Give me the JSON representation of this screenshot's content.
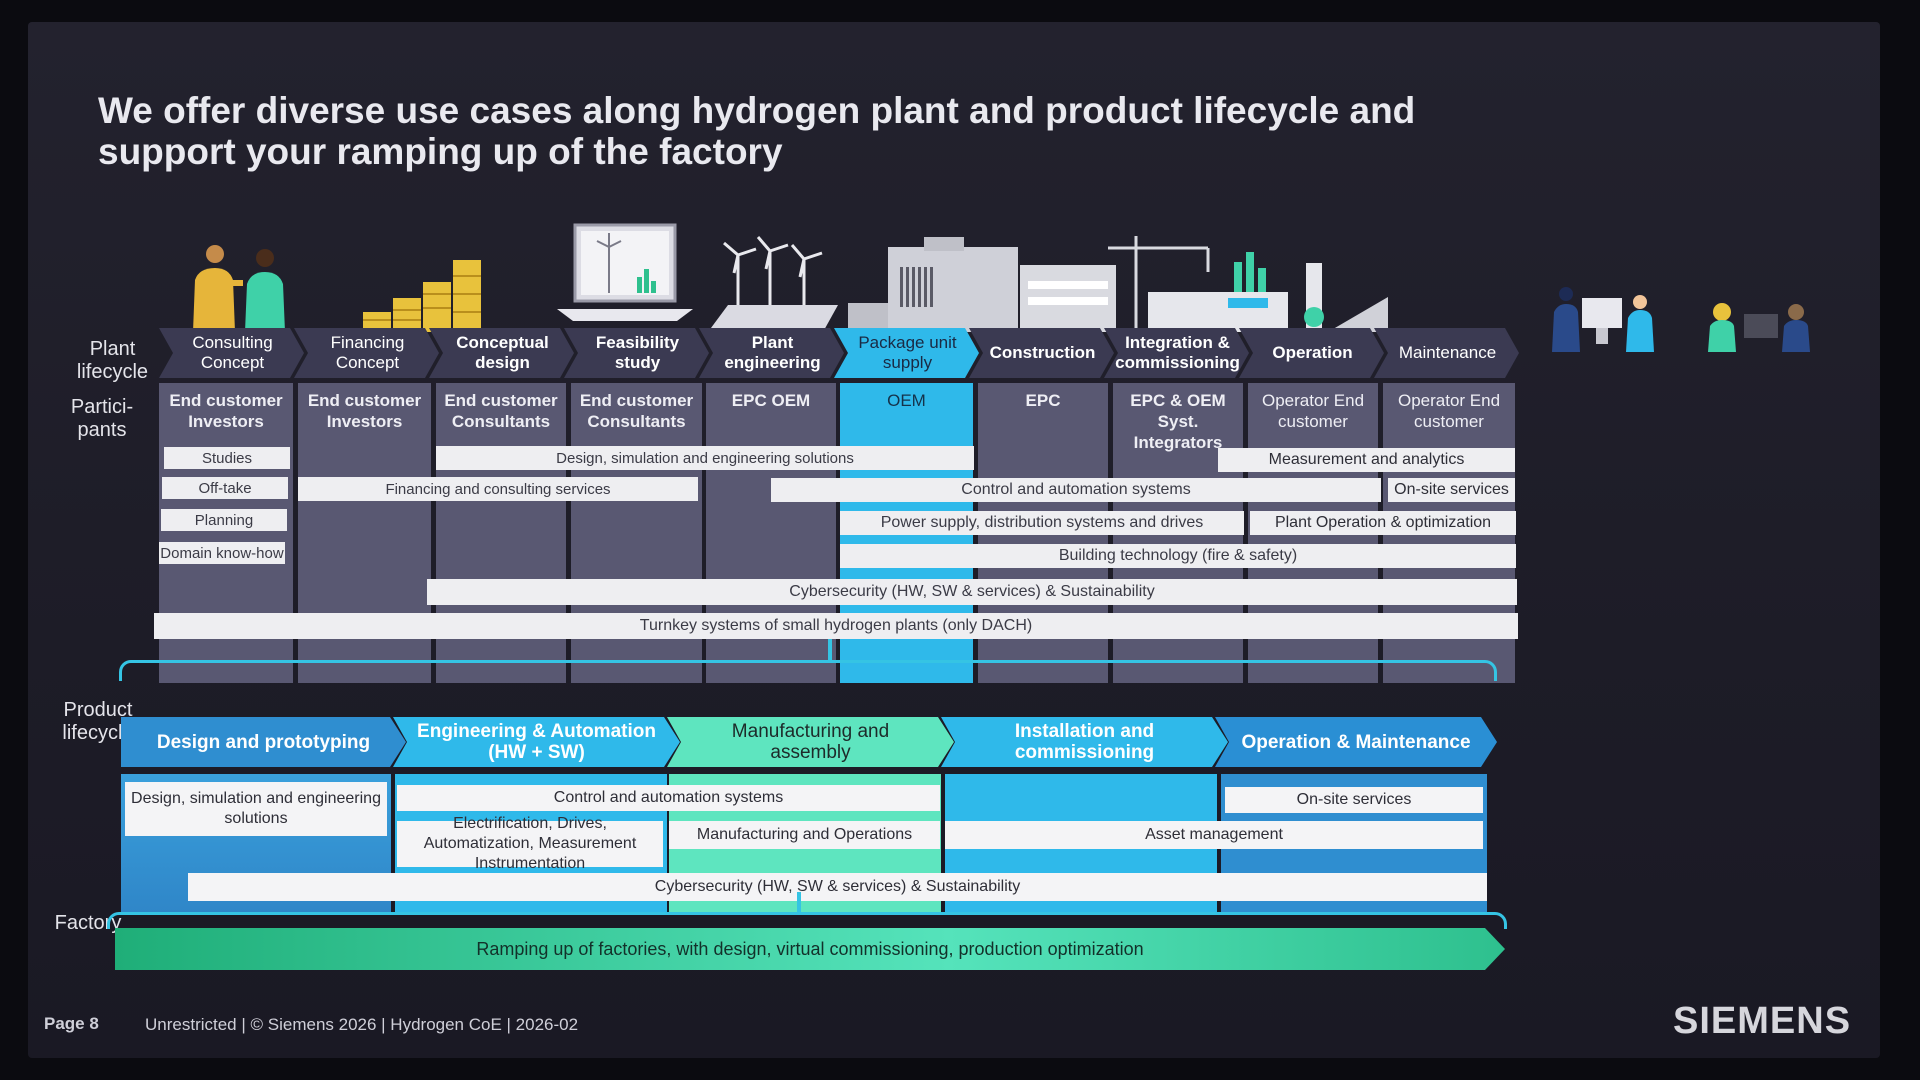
{
  "title": "We offer diverse use cases along hydrogen plant and product lifecycle and support your ramping up of the factory",
  "labels": {
    "plant_lifecycle": "Plant lifecycle",
    "participants": "Partici- pants",
    "product_lifecycle": "Product lifecycle",
    "factory": "Factory"
  },
  "plant": {
    "stages": [
      "Consulting Concept",
      "Financing Concept",
      "Conceptual design",
      "Feasibility study",
      "Plant engineering",
      "Package unit supply",
      "Construction",
      "Integration & commissioning",
      "Operation",
      "Maintenance"
    ],
    "participants": [
      "End customer Investors",
      "End customer Investors",
      "End customer Consultants",
      "End customer Consultants",
      "EPC OEM",
      "OEM",
      "EPC",
      "EPC & OEM Syst. Integrators",
      "Operator End customer",
      "Operator End customer"
    ],
    "small_items": [
      "Studies",
      "Off-take",
      "Planning",
      "Domain know-how"
    ],
    "bars": {
      "design": "Design, simulation and engineering solutions",
      "financing": "Financing and consulting services",
      "measurement": "Measurement and analytics",
      "control": "Control and automation systems",
      "onsite": "On-site services",
      "power": "Power supply, distribution systems and drives",
      "plant_op": "Plant Operation & optimization",
      "building": "Building technology (fire & safety)",
      "cyber": "Cybersecurity (HW, SW & services) & Sustainability",
      "turnkey": "Turnkey systems of small hydrogen plants (only DACH)"
    }
  },
  "product": {
    "stages": [
      "Design and prototyping",
      "Engineering & Automation (HW + SW)",
      "Manufacturing and assembly",
      "Installation and commissioning",
      "Operation & Maintenance"
    ],
    "bars": {
      "design": "Design, simulation and engineering solutions",
      "control": "Control and automation systems",
      "onsite": "On-site services",
      "electrification": "Electrification, Drives, Automatization, Measurement Instrumentation",
      "manufacturing_ops": "Manufacturing and Operations",
      "asset": "Asset management",
      "cyber": "Cybersecurity (HW, SW & services) & Sustainability"
    }
  },
  "factory_bar": "Ramping up of factories, with design, virtual commissioning, production optimization",
  "footer": {
    "page": "Page 8",
    "text": "Unrestricted | © Siemens 2026 | Hydrogen CoE | 2026-02",
    "logo": "SIEMENS"
  },
  "colors": {
    "slate": "#595872",
    "chevron": "#3b3a52",
    "cyan": "#2fb9ea",
    "mint": "#5ee5bf",
    "green": "#2ec08e"
  },
  "icons": [
    "people-icon",
    "coins-icon",
    "laptop-windmill-icon",
    "windfarm-icon",
    "electrolyzer-icon",
    "crane-factory-icon",
    "industrial-plant-icon",
    "operators-icon",
    "maintenance-workers-icon"
  ]
}
